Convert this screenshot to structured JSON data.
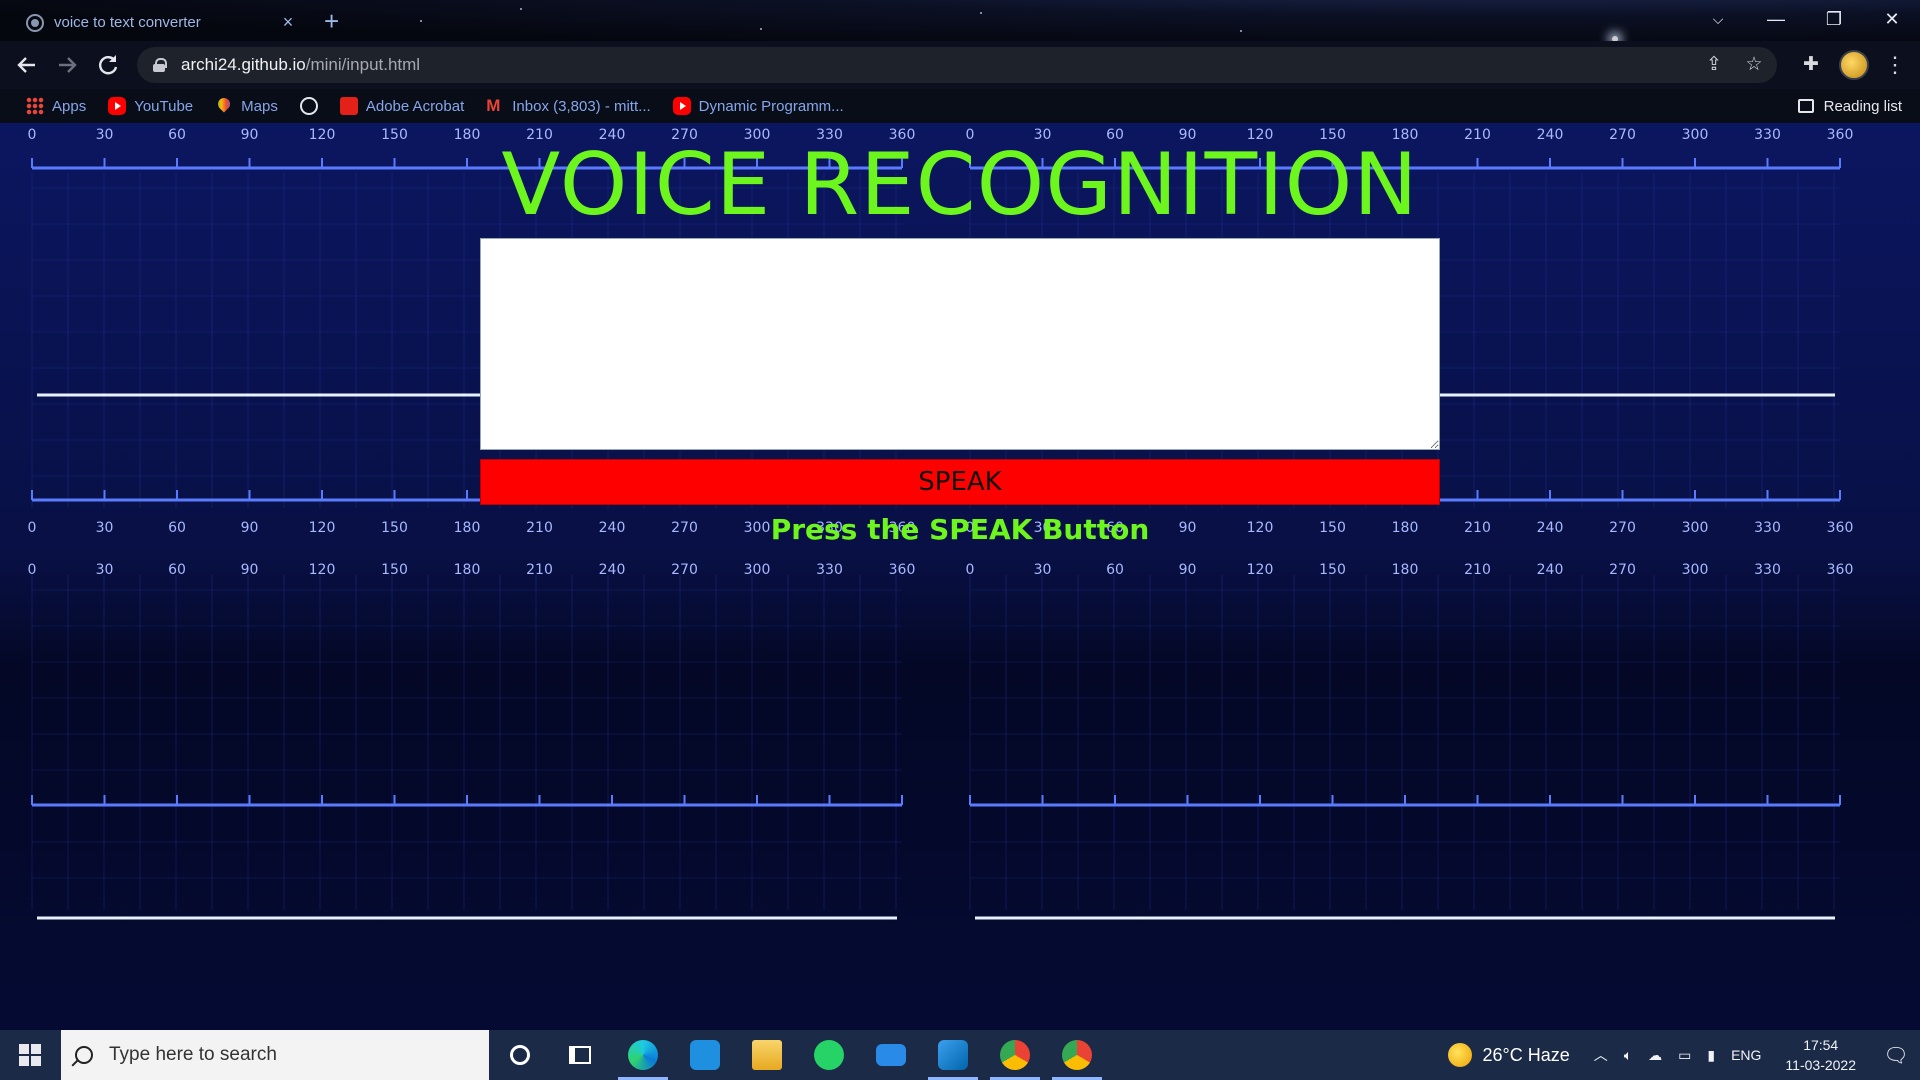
{
  "browser": {
    "tab_title": "voice to text converter",
    "tab_close": "×",
    "new_tab": "+",
    "window_controls": {
      "tabsearch": "⌵",
      "minimize": "—",
      "restore": "❐",
      "close": "✕"
    },
    "url_host": "archi24.github.io",
    "url_path": "/mini/input.html",
    "bookmarks": [
      {
        "label": "Apps",
        "icon": "apps-icon"
      },
      {
        "label": "YouTube",
        "icon": "youtube-icon"
      },
      {
        "label": "Maps",
        "icon": "maps-icon"
      },
      {
        "label": "",
        "icon": "globe-icon"
      },
      {
        "label": "Adobe Acrobat",
        "icon": "acrobat-icon"
      },
      {
        "label": "Inbox (3,803) - mitt...",
        "icon": "gmail-icon"
      },
      {
        "label": "Dynamic Programm...",
        "icon": "youtube-icon"
      }
    ],
    "reading_list": "Reading list"
  },
  "page": {
    "title": "VOICE RECOGNITION",
    "textarea_value": "",
    "speak_label": "SPEAK",
    "hint": "Press the SPEAK Button",
    "ruler_ticks": [
      "0",
      "30",
      "60",
      "90",
      "120",
      "150",
      "180",
      "210",
      "240",
      "270",
      "300",
      "330",
      "360"
    ],
    "colors": {
      "title": "#6df61d",
      "button": "#ff0000",
      "background": "#0b1660"
    }
  },
  "taskbar": {
    "search_placeholder": "Type here to search",
    "apps": [
      "cortana-icon",
      "task-view-icon",
      "edge-icon",
      "store-icon",
      "file-explorer-icon",
      "whatsapp-icon",
      "mail-icon",
      "vscode-icon",
      "chrome-icon",
      "chrome-profile-icon"
    ],
    "weather": "26°C  Haze",
    "language": "ENG",
    "time": "17:54",
    "date": "11-03-2022"
  }
}
